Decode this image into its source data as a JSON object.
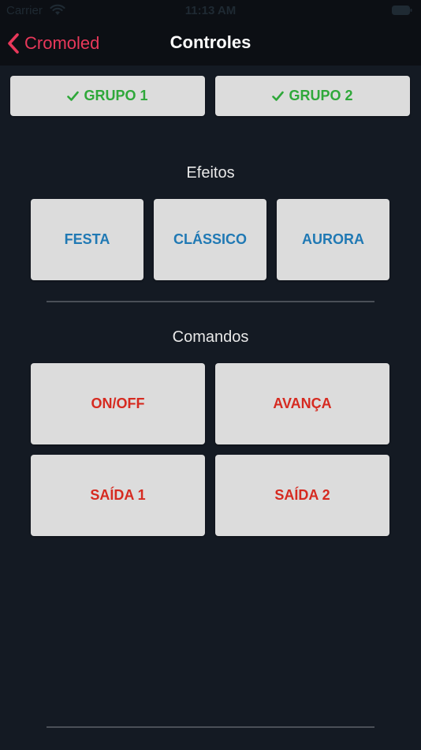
{
  "status_bar": {
    "carrier": "Carrier",
    "time": "11:13 AM",
    "wifi_icon": "wifi-icon",
    "battery_icon": "battery-icon"
  },
  "nav": {
    "back_label": "Cromoled",
    "back_icon": "chevron-left-icon",
    "title": "Controles",
    "accent": "#e8385a"
  },
  "groups": [
    {
      "label": "GRUPO 1",
      "checked": true
    },
    {
      "label": "GRUPO 2",
      "checked": true
    }
  ],
  "effects": {
    "heading": "Efeitos",
    "buttons": [
      "FESTA",
      "CLÁSSICO",
      "AURORA"
    ]
  },
  "commands": {
    "heading": "Comandos",
    "buttons": [
      "ON/OFF",
      "AVANÇA",
      "SAÍDA 1",
      "SAÍDA 2"
    ]
  },
  "colors": {
    "background": "#141a23",
    "button": "#dcdcdc",
    "group_text": "#2fa83a",
    "effect_text": "#2079b4",
    "command_text": "#d62a20"
  }
}
